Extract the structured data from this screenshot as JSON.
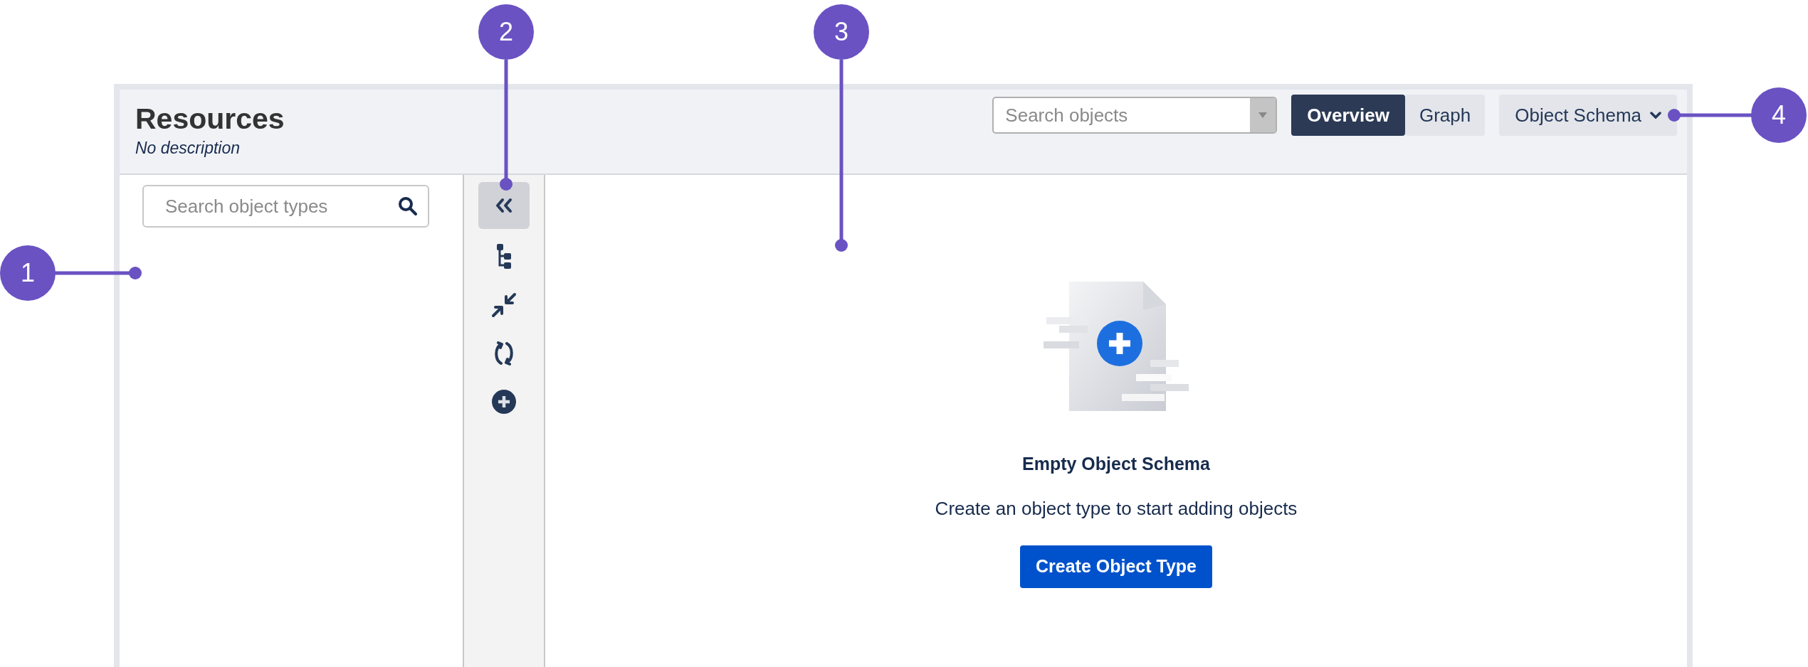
{
  "header": {
    "title": "Resources",
    "description": "No description",
    "search": {
      "placeholder": "Search objects"
    },
    "view_tabs": [
      {
        "label": "Overview",
        "selected": true
      },
      {
        "label": "Graph",
        "selected": false
      }
    ],
    "schema_menu": {
      "label": "Object Schema"
    }
  },
  "sidebar": {
    "search": {
      "placeholder": "Search object types"
    }
  },
  "toolbar": {
    "items": [
      {
        "kind": "collapse",
        "selected": true
      },
      {
        "kind": "tree",
        "selected": false
      },
      {
        "kind": "shrink",
        "selected": false
      },
      {
        "kind": "refresh",
        "selected": false
      },
      {
        "kind": "add",
        "selected": false
      }
    ]
  },
  "empty_state": {
    "title": "Empty Object Schema",
    "message": "Create an object type to start adding objects",
    "button": "Create Object Type"
  },
  "callouts": [
    {
      "label": "1"
    },
    {
      "label": "2"
    },
    {
      "label": "3"
    },
    {
      "label": "4"
    }
  ]
}
